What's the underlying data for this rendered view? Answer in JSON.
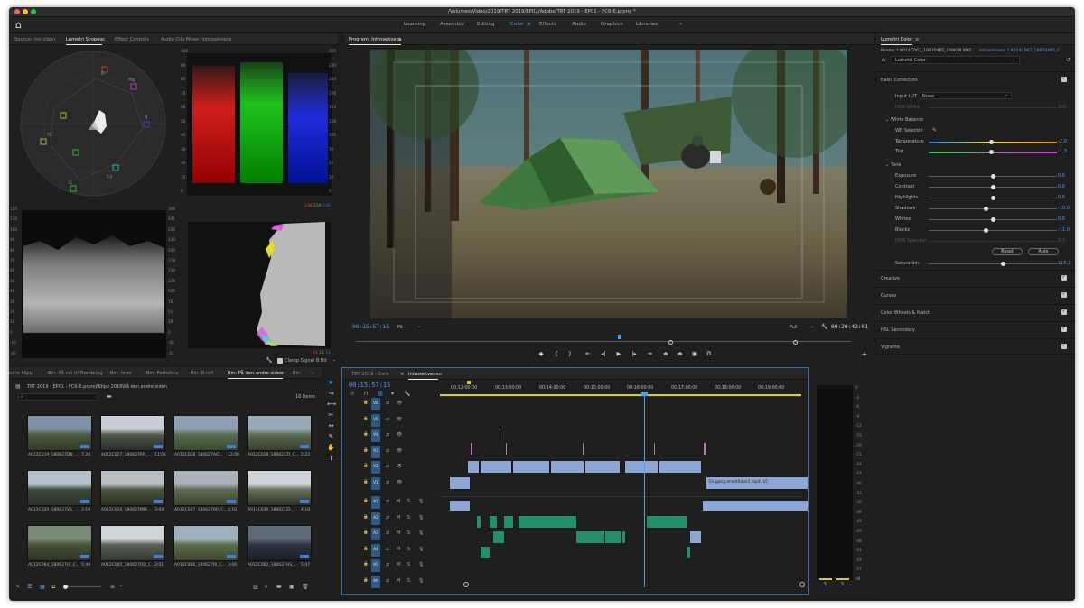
{
  "window": {
    "title": "/Volumes/Video/2019/TRT 2019/EP02/Adobe/TRT 2019 - EP01 - FC6-6.prproj *"
  },
  "workspaces": [
    {
      "label": "Learning",
      "active": false
    },
    {
      "label": "Assembly",
      "active": false
    },
    {
      "label": "Editing",
      "active": false
    },
    {
      "label": "Color",
      "active": true
    },
    {
      "label": "Effects",
      "active": false
    },
    {
      "label": "Audio",
      "active": false
    },
    {
      "label": "Graphics",
      "active": false
    },
    {
      "label": "Libraries",
      "active": false
    }
  ],
  "workspace_more": "»",
  "scopes_panel": {
    "tabs": [
      "Source: (no clips)",
      "Lumetri Scopes",
      "Effect Controls",
      "Audio Clip Mixer: Introsekvens"
    ],
    "active_tab": "Lumetri Scopes",
    "vectorscope_labels": [
      "R",
      "Mg",
      "B",
      "Cy",
      "G",
      "YL"
    ],
    "parade_scale_left": [
      "100",
      "90",
      "80",
      "70",
      "60",
      "50",
      "40",
      "30",
      "20",
      "10",
      "0"
    ],
    "parade_scale_right": [
      "255",
      "230",
      "204",
      "178",
      "153",
      "128",
      "102",
      "76",
      "51",
      "26",
      "0"
    ],
    "waveform_scale_left": [
      "120",
      "110",
      "100",
      "90",
      "80",
      "70",
      "60",
      "50",
      "40",
      "30",
      "20",
      "10",
      "0",
      "-10",
      "-20"
    ],
    "waveform_scale_right": [
      "306",
      "281",
      "255",
      "230",
      "204",
      "178",
      "153",
      "128",
      "102",
      "76",
      "51",
      "26",
      "0",
      "-26",
      "-51"
    ],
    "parade_readout": {
      "r": "238",
      "g": "234",
      "b": "236"
    },
    "histogram_readout": {
      "r": "14",
      "g": "13",
      "b": "11"
    },
    "clamp_signal_label": "Clamp Signal",
    "bit_depth": "8 Bit"
  },
  "program_monitor": {
    "title": "Program: Introsekvens",
    "timecode_current": "00:15:57:15",
    "zoom": "Fit",
    "quality": "Full",
    "timecode_duration": "00:20:42:01"
  },
  "lumetri_color": {
    "panel_title": "Lumetri Color",
    "master_clip": "Master * A014C067_180704P5_CANON.MXF",
    "sequence_clip": "Introsekvens * A014C067_180704P5_C...",
    "fx_label": "fx",
    "effect_name": "Lumetri Color",
    "basic_correction": "Basic Correction",
    "input_lut_label": "Input LUT",
    "input_lut_value": "None",
    "hdr_white_label": "HDR White",
    "hdr_white_value": "100",
    "white_balance": "White Balance",
    "wb_selector": "WB Selector",
    "temperature": {
      "label": "Temperature",
      "value": "-2,0",
      "level": 0.49
    },
    "tint": {
      "label": "Tint",
      "value": "-1,3",
      "level": 0.49
    },
    "tone": "Tone",
    "tone_rows": [
      {
        "label": "Exposure",
        "value": "0,0",
        "level": 0.5
      },
      {
        "label": "Contrast",
        "value": "0,0",
        "level": 0.5
      },
      {
        "label": "Highlights",
        "value": "0,0",
        "level": 0.5
      },
      {
        "label": "Shadows",
        "value": "-10,0",
        "level": 0.45
      },
      {
        "label": "Whites",
        "value": "0,0",
        "level": 0.5
      },
      {
        "label": "Blacks",
        "value": "-11,0",
        "level": 0.445
      }
    ],
    "hdr_specular_label": "HDR Specular",
    "hdr_specular_value": "0,0",
    "reset_label": "Reset",
    "auto_label": "Auto",
    "saturation": {
      "label": "Saturation",
      "value": "116,2",
      "level": 0.58
    },
    "sections": [
      "Creative",
      "Curves",
      "Color Wheels & Match",
      "HSL Secondary",
      "Vignette"
    ]
  },
  "project_panel": {
    "tabs": [
      "ndre klipp",
      "Bin: På vei til Trøndelag",
      "Bin: Intro",
      "Bin: Forhekka",
      "Bin: B-roll",
      "Bin: På den andre siden",
      "Bin:"
    ],
    "active_tab": "Bin: På den andre siden",
    "more": "»",
    "path": "TRT 2019 - EP01 - FC6-6.prproj\\Klipp 2018\\På den andre siden",
    "item_count": "16 Items",
    "clips": [
      {
        "name": "A012C019_180627DN_...",
        "duration": "7:24"
      },
      {
        "name": "A012C027_180627RR_...",
        "duration": "11:01"
      },
      {
        "name": "A012C028_180627AO...",
        "duration": "12:00"
      },
      {
        "name": "A012C018_180627ZI_C...",
        "duration": "2:22"
      },
      {
        "name": "A012C020_180627VS_...",
        "duration": "3:19"
      },
      {
        "name": "A012C026_180627MM...",
        "duration": "3:04"
      },
      {
        "name": "A012C027_180627RR_C...",
        "duration": "4:10"
      },
      {
        "name": "A012C030_180627ZL_...",
        "duration": "4:18"
      },
      {
        "name": "A012C084_180627UI_C...",
        "duration": "5:49"
      },
      {
        "name": "A012C085_180627OD_C...",
        "duration": "3:01"
      },
      {
        "name": "A012C086_180627RI_C...",
        "duration": "3:06"
      },
      {
        "name": "A012C062_180627HS_...",
        "duration": "5:07"
      }
    ]
  },
  "timeline": {
    "tabs": [
      "TRT 2019 - Core",
      "Introsekvens"
    ],
    "active_tab": "Introsekvens",
    "timecode": "00:15:57:15",
    "ruler": [
      "00:12:00:00",
      "00:13:00:00",
      "00:14:00:00",
      "00:15:00:00",
      "00:16:00:00",
      "00:17:00:00",
      "00:18:00:00",
      "00:19:00:00"
    ],
    "video_tracks": [
      "V6",
      "V5",
      "V4",
      "V3",
      "V2",
      "V1"
    ],
    "audio_tracks": [
      "A1",
      "A2",
      "A3",
      "A4",
      "A5",
      "A6"
    ],
    "audio_ms_labels": [
      "M",
      "S"
    ],
    "clip_label": "En gang ensetfoker2.mp4 [V]"
  },
  "audio_meter": {
    "scale": [
      "0",
      "-3",
      "-6",
      "-9",
      "-12",
      "-15",
      "-18",
      "-21",
      "-24",
      "-27",
      "-30",
      "-33",
      "-36",
      "-39",
      "-42",
      "-45",
      "-48",
      "-51",
      "-54",
      "-57",
      "dB"
    ],
    "solo_labels": [
      "S",
      "S"
    ]
  }
}
